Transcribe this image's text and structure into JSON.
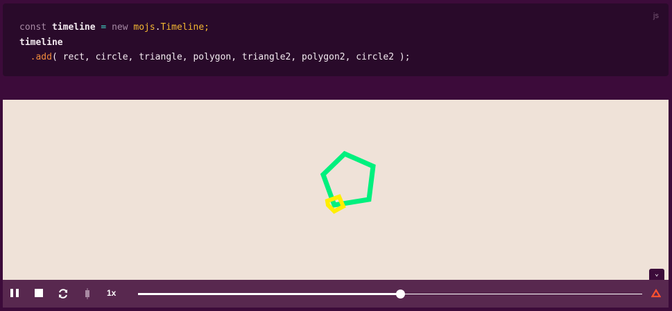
{
  "code": {
    "language": "js",
    "line1": {
      "kw1": "const",
      "var": "timeline",
      "op": "=",
      "kw2": "new",
      "obj": "mojs",
      "dot": ".",
      "cls": "Timeline",
      "end": ";"
    },
    "line2": "timeline",
    "line3": {
      "method": ".add",
      "args": "( rect, circle, triangle, polygon, triangle2, polygon2, circle2 );"
    }
  },
  "player": {
    "speed_label": "1x",
    "progress": 0.52,
    "accent": "#ff512f"
  },
  "colors": {
    "shape_green": "#00f07e",
    "shape_yellow": "#ffee00"
  }
}
